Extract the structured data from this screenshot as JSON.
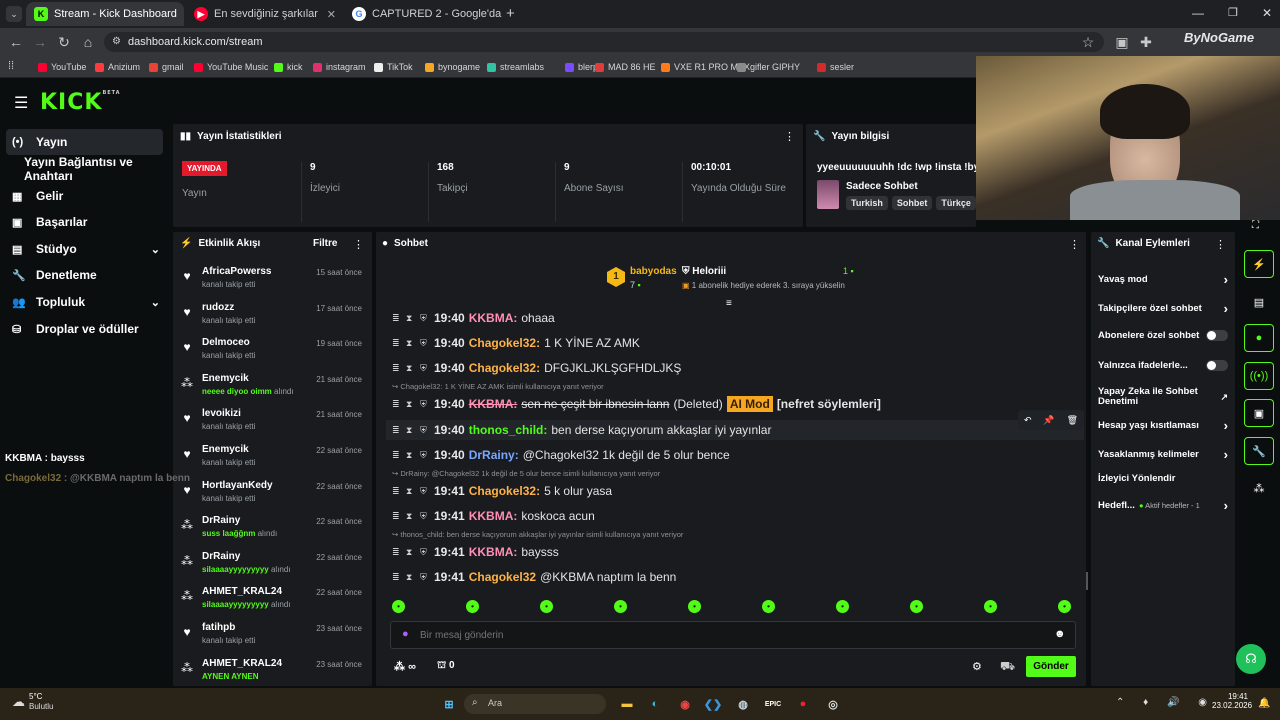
{
  "browser": {
    "tabs": [
      {
        "title": "Stream - Kick Dashboard",
        "fav": "K",
        "fav_color": "#53fc18"
      },
      {
        "title": "En sevdiğiniz şarkılar ve albüml",
        "fav": "▶",
        "fav_color": "#ff0033"
      },
      {
        "title": "CAPTURED 2 - Google'da Ara",
        "fav": "G",
        "fav_color": "#ffffff"
      }
    ],
    "new_tab": "+",
    "url": "dashboard.kick.com/stream",
    "bookmarks": [
      {
        "label": "YouTube",
        "color": "#ff0033"
      },
      {
        "label": "Anizium",
        "color": "#ff3b3b"
      },
      {
        "label": "gmail",
        "color": "#ea4335"
      },
      {
        "label": "YouTube Music",
        "color": "#ff0033"
      },
      {
        "label": "kick",
        "color": "#53fc18"
      },
      {
        "label": "instagram",
        "color": "#e1306c"
      },
      {
        "label": "TikTok",
        "color": "#eeeeee"
      },
      {
        "label": "bynogame",
        "color": "#f5a623"
      },
      {
        "label": "streamlabs",
        "color": "#31c3a2"
      },
      {
        "label": "blerp",
        "color": "#7a4cff"
      },
      {
        "label": "MAD 86 HE",
        "color": "#e23b3b"
      },
      {
        "label": "VXE R1 PRO MAX",
        "color": "#ff7a1a"
      },
      {
        "label": "gifler GIPHY",
        "color": "#8a8a8a"
      },
      {
        "label": "sesler",
        "color": "#d42a2a"
      }
    ]
  },
  "kick": {
    "logo": "KICK",
    "logo_sup": "BETA",
    "sidebar": [
      {
        "label": "Yayın",
        "icon": "(•)"
      },
      {
        "label": "Yayın Bağlantısı ve Anahtarı",
        "icon": ""
      },
      {
        "label": "Gelir",
        "icon": "▦"
      },
      {
        "label": "Başarılar",
        "icon": "▣"
      },
      {
        "label": "Stüdyo",
        "icon": "▤"
      },
      {
        "label": "Denetleme",
        "icon": "🔧"
      },
      {
        "label": "Topluluk",
        "icon": "👥"
      },
      {
        "label": "Droplar ve ödüller",
        "icon": "⛁"
      }
    ],
    "stats": {
      "title": "Yayın İstatistikleri",
      "live_badge": "YAYINDA",
      "live_label": "Yayın",
      "items": [
        {
          "value": "9",
          "label": "İzleyici"
        },
        {
          "value": "168",
          "label": "Takipçi"
        },
        {
          "value": "9",
          "label": "Abone Sayısı"
        },
        {
          "value": "00:10:01",
          "label": "Yayında Olduğu Süre"
        }
      ]
    },
    "info": {
      "title": "Yayın bilgisi",
      "stream_title": "yyeeuuuuuuuhh !dc !wp !insta !byn",
      "category": "Sadece Sohbet",
      "tags": [
        "Turkish",
        "Sohbet",
        "Türkçe"
      ]
    },
    "activity": {
      "title": "Etkinlik Akışı",
      "filter": "Filtre",
      "items": [
        {
          "name": "AfricaPowerss",
          "time": "15 saat önce",
          "sub": "kanalı takip etti",
          "gift": "",
          "icon": "♥"
        },
        {
          "name": "rudozz",
          "time": "17 saat önce",
          "sub": "kanalı takip etti",
          "gift": "",
          "icon": "♥"
        },
        {
          "name": "Delmoceo",
          "time": "19 saat önce",
          "sub": "kanalı takip etti",
          "gift": "",
          "icon": "♥"
        },
        {
          "name": "Enemycik",
          "time": "21 saat önce",
          "sub": "alındı",
          "gift": "neeee diyoo oimm",
          "icon": "⁂"
        },
        {
          "name": "levoikizi",
          "time": "21 saat önce",
          "sub": "kanalı takip etti",
          "gift": "",
          "icon": "♥"
        },
        {
          "name": "Enemycik",
          "time": "22 saat önce",
          "sub": "kanalı takip etti",
          "gift": "",
          "icon": "♥"
        },
        {
          "name": "HortlayanKedy",
          "time": "22 saat önce",
          "sub": "kanalı takip etti",
          "gift": "",
          "icon": "♥"
        },
        {
          "name": "DrRainy",
          "time": "22 saat önce",
          "sub": "alındı",
          "gift": "suss laağğnm",
          "icon": "⁂"
        },
        {
          "name": "DrRainy",
          "time": "22 saat önce",
          "sub": "alındı",
          "gift": "silaaaayyyyyyyyy",
          "icon": "⁂"
        },
        {
          "name": "AHMET_KRAL24",
          "time": "22 saat önce",
          "sub": "alındı",
          "gift": "silaaaayyyyyyyyy",
          "icon": "⁂"
        },
        {
          "name": "fatihpb",
          "time": "23 saat önce",
          "sub": "kanalı takip etti",
          "gift": "",
          "icon": "♥"
        },
        {
          "name": "AHMET_KRAL24",
          "time": "23 saat önce",
          "sub": "",
          "gift": "AYNEN AYNEN",
          "icon": "⁂"
        }
      ]
    },
    "chat": {
      "title": "Sohbet",
      "pinned": {
        "rank": "1",
        "user1": "babyodas",
        "user1_count": "7",
        "user2": "Heloriii",
        "user2_count": "1",
        "gift_text": "1 abonelik hediye ederek 3. sıraya yükselin"
      },
      "messages": [
        {
          "reply": "",
          "time": "19:40",
          "user": "KKBMA:",
          "color": "#ff8fb3",
          "text": "ohaaa",
          "extra": "",
          "tag": "",
          "tag2": ""
        },
        {
          "reply": "",
          "time": "19:40",
          "user": "Chagokel32:",
          "color": "#ffb347",
          "text": "1 K YİNE AZ AMK",
          "extra": "",
          "tag": "",
          "tag2": ""
        },
        {
          "reply": "",
          "time": "19:40",
          "user": "Chagokel32:",
          "color": "#ffb347",
          "text": "DFGJKLJKLŞGFHDLJKŞ",
          "extra": "",
          "tag": "",
          "tag2": ""
        },
        {
          "reply": "Chagokel32: 1 K YİNE AZ AMK isimli kullanıcıya yanıt veriyor",
          "time": "19:40",
          "user": "KKBMA:",
          "color": "#ff8fb3",
          "text": "sen ne çeşit bir ibnesin lann",
          "extra": "(Deleted)",
          "tag": "AI Mod",
          "tag2": "[nefret söylemleri]"
        },
        {
          "reply": "",
          "time": "19:40",
          "user": "thonos_child:",
          "color": "#53fc18",
          "text": "ben derse kaçıyorum akkaşlar iyi yayınlar",
          "extra": "",
          "tag": "",
          "tag2": ""
        },
        {
          "reply": "",
          "time": "19:40",
          "user": "DrRainy:",
          "color": "#7aa7ff",
          "text": "@Chagokel32 1k değil de 5 olur bence",
          "extra": "",
          "tag": "",
          "tag2": ""
        },
        {
          "reply": "DrRainy: @Chagokel32 1k değil de 5 olur bence isimli kullanıcıya yanıt veriyor",
          "time": "19:41",
          "user": "Chagokel32:",
          "color": "#ffb347",
          "text": "5 k olur yasa",
          "extra": "",
          "tag": "",
          "tag2": ""
        },
        {
          "reply": "",
          "time": "19:41",
          "user": "KKBMA:",
          "color": "#ff8fb3",
          "text": "koskoca acun",
          "extra": "",
          "tag": "",
          "tag2": ""
        },
        {
          "reply": "thonos_child: ben derse kaçıyorum akkaşlar iyi yayınlar isimli kullanıcıya yanıt veriyor",
          "time": "19:41",
          "user": "KKBMA:",
          "color": "#ff8fb3",
          "text": "baysss",
          "extra": "",
          "tag": "",
          "tag2": ""
        },
        {
          "reply": "",
          "time": "19:41",
          "user": "Chagokel32",
          "color": "#ffb347",
          "text": "@KKBMA naptım la benn",
          "extra": "",
          "tag": "",
          "tag2": ""
        }
      ],
      "input_placeholder": "Bir mesaj gönderin",
      "points": "∞",
      "count": "0",
      "send": "Gönder"
    },
    "channel_actions": {
      "title": "Kanal Eylemleri",
      "items": [
        {
          "label": "Yavaş mod",
          "control": "chevron",
          "sub": ""
        },
        {
          "label": "Takipçilere özel sohbet",
          "control": "chevron",
          "sub": ""
        },
        {
          "label": "Abonelere özel sohbet",
          "control": "toggle",
          "sub": ""
        },
        {
          "label": "Yalnızca ifadelerle...",
          "control": "toggle",
          "sub": ""
        },
        {
          "label": "Yapay Zeka ile Sohbet Denetimi",
          "control": "external",
          "sub": ""
        },
        {
          "label": "Hesap yaşı kısıtlaması",
          "control": "chevron",
          "sub": ""
        },
        {
          "label": "Yasaklanmış kelimeler",
          "control": "chevron",
          "sub": ""
        },
        {
          "label": "İzleyici Yönlendir",
          "control": "",
          "sub": ""
        },
        {
          "label": "Hedefl...",
          "control": "chevron",
          "sub": "Aktif hedefler - 1"
        }
      ]
    }
  },
  "overlay": {
    "brand": "ByNoGame",
    "lines": [
      {
        "user": "KKBMA",
        "text": " : baysss",
        "color": "#ffffff"
      },
      {
        "user": "Chagokel32",
        "text": " : @KKBMA naptım la benn",
        "color": "#7a6a3a"
      }
    ]
  },
  "taskbar": {
    "weather_temp": "5°C",
    "weather_desc": "Bulutlu",
    "search": "Ara",
    "time": "19:41",
    "date": "23.02.2026"
  }
}
